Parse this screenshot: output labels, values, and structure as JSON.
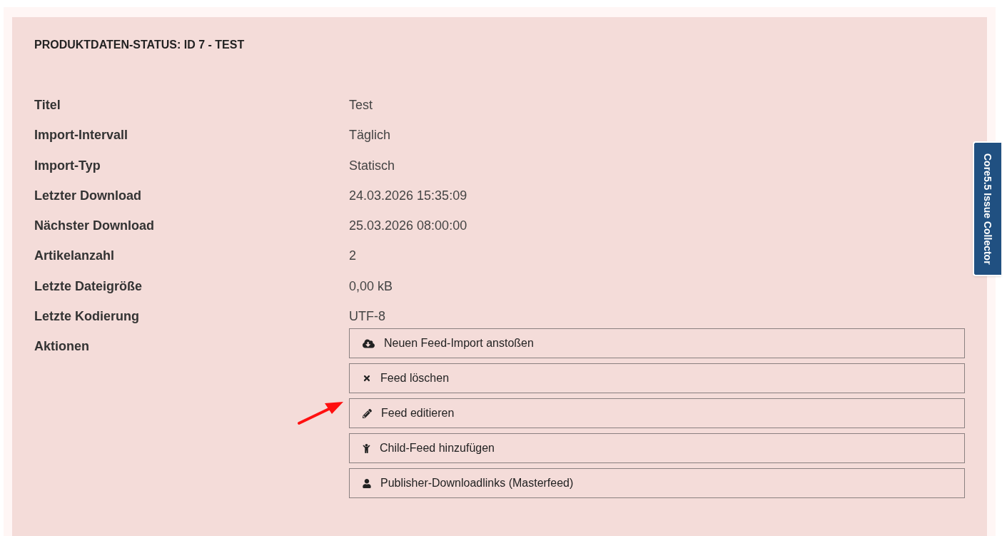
{
  "panel": {
    "title": "PRODUKTDATEN-STATUS: ID 7 - TEST"
  },
  "fields": [
    {
      "label": "Titel",
      "value": "Test"
    },
    {
      "label": "Import-Intervall",
      "value": "Täglich"
    },
    {
      "label": "Import-Typ",
      "value": "Statisch"
    },
    {
      "label": "Letzter Download",
      "value": "24.03.2026 15:35:09"
    },
    {
      "label": "Nächster Download",
      "value": "25.03.2026 08:00:00"
    },
    {
      "label": "Artikelanzahl",
      "value": "2"
    },
    {
      "label": "Letzte Dateigröße",
      "value": "0,00 kB"
    },
    {
      "label": "Letzte Kodierung",
      "value": "UTF-8"
    }
  ],
  "actions": {
    "label": "Aktionen",
    "buttons": [
      {
        "kind": "cloud-download",
        "label": "Neuen Feed-Import anstoßen",
        "highlighted": false
      },
      {
        "kind": "delete",
        "label": "Feed löschen",
        "highlighted": false
      },
      {
        "kind": "edit",
        "label": "Feed editieren",
        "highlighted": true
      },
      {
        "kind": "child",
        "label": "Child-Feed hinzufügen",
        "highlighted": false
      },
      {
        "kind": "user",
        "label": "Publisher-Downloadlinks (Masterfeed)",
        "highlighted": false
      }
    ]
  },
  "side_tab": {
    "label": "Core5.5 Issue Collector"
  }
}
